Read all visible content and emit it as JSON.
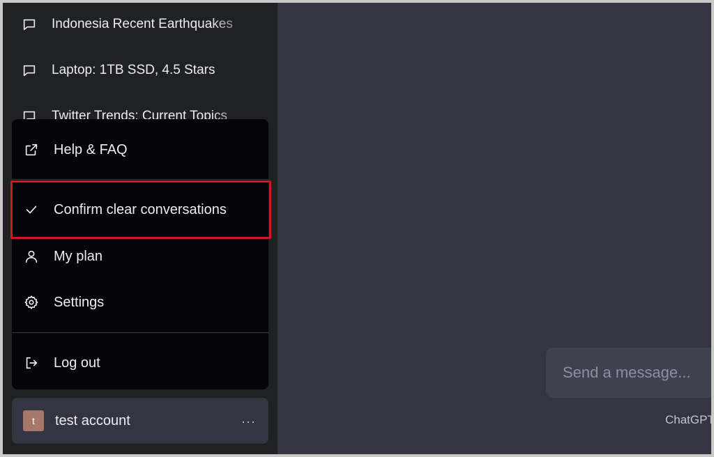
{
  "sidebar": {
    "history": [
      {
        "label": "Indonesia Recent Earthquakes",
        "icon": "chat-bubble-icon"
      },
      {
        "label": "Laptop: 1TB SSD, 4.5 Stars",
        "icon": "chat-bubble-icon"
      },
      {
        "label": "Twitter Trends: Current Topics",
        "icon": "chat-bubble-icon"
      }
    ]
  },
  "menu": {
    "items": [
      {
        "label": "Help & FAQ",
        "icon": "external-link-icon"
      },
      {
        "label": "Confirm clear conversations",
        "icon": "check-icon"
      },
      {
        "label": "My plan",
        "icon": "user-icon"
      },
      {
        "label": "Settings",
        "icon": "gear-icon"
      },
      {
        "label": "Log out",
        "icon": "logout-icon"
      }
    ]
  },
  "account": {
    "avatar_letter": "t",
    "name": "test account",
    "more_label": "···"
  },
  "composer": {
    "placeholder": "Send a message..."
  },
  "footer": {
    "text": "ChatGPT"
  },
  "colors": {
    "highlight": "#d0161e",
    "main_bg": "#343541",
    "sidebar_bg": "#202123",
    "menu_bg": "#050509"
  }
}
